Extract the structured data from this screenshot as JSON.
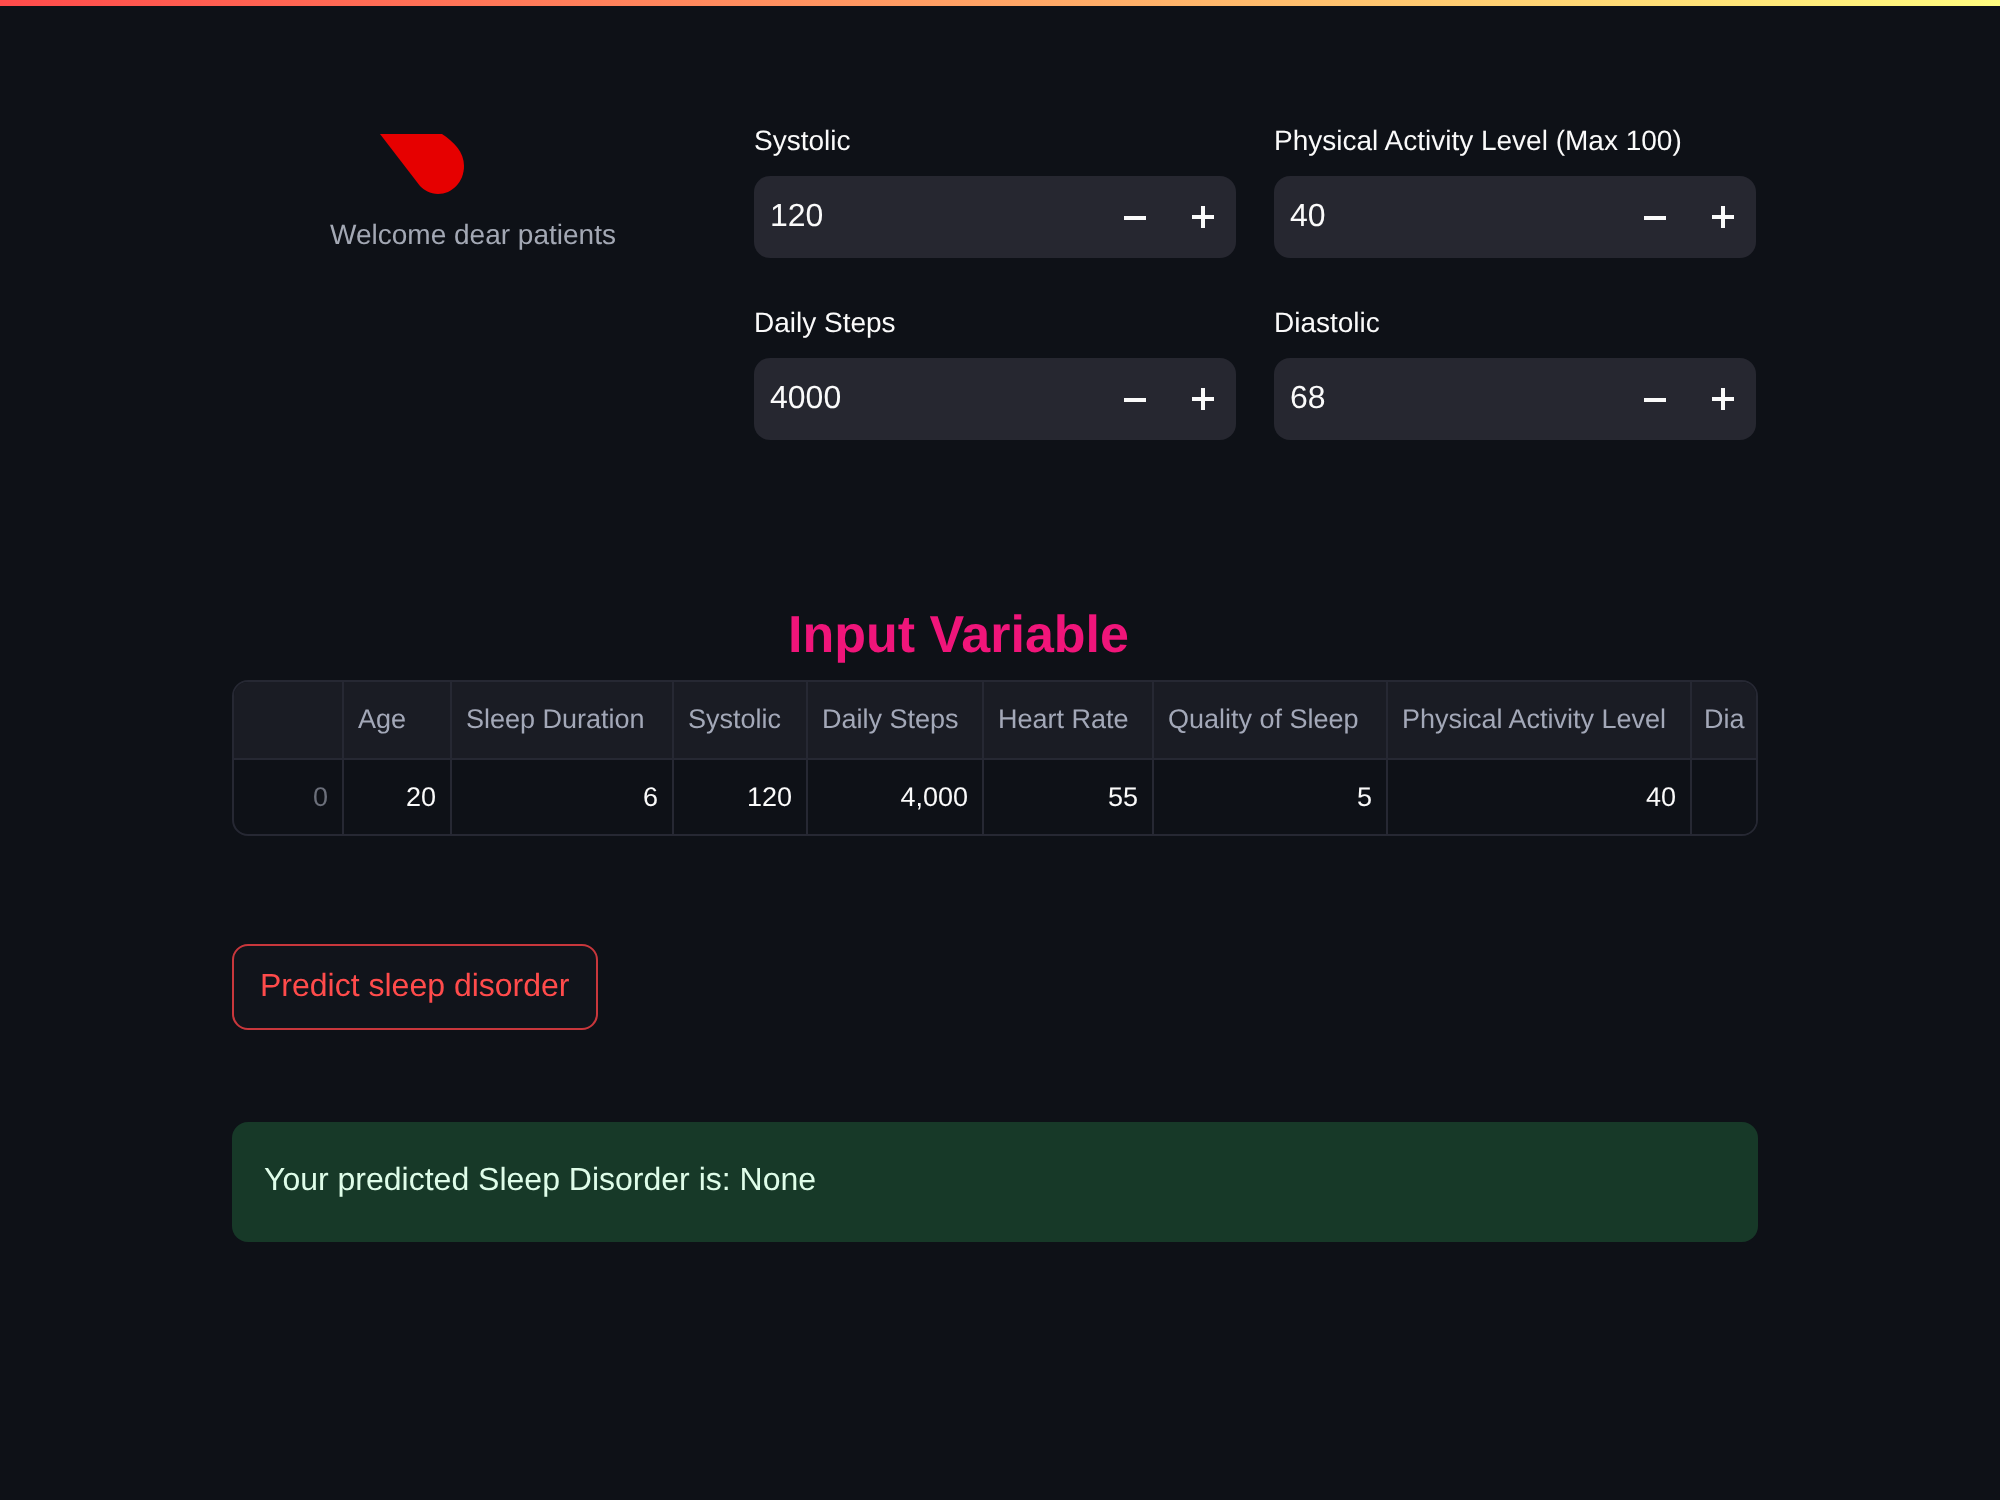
{
  "intro": {
    "welcome_text": "Welcome dear patients"
  },
  "number_inputs": [
    {
      "label": "Systolic",
      "value": "120"
    },
    {
      "label": "Physical Activity Level (Max 100)",
      "value": "40"
    },
    {
      "label": "Daily Steps",
      "value": "4000"
    },
    {
      "label": "Diastolic",
      "value": "68"
    }
  ],
  "section_title": "Input Variable",
  "table": {
    "columns": [
      "Age",
      "Sleep Duration",
      "Systolic",
      "Daily Steps",
      "Heart Rate",
      "Quality of Sleep",
      "Physical Activity Level",
      "Dia"
    ],
    "rows": [
      {
        "index": "0",
        "cells": [
          "20",
          "6",
          "120",
          "4,000",
          "55",
          "5",
          "40"
        ]
      }
    ]
  },
  "predict_button": {
    "label": "Predict sleep disorder"
  },
  "result": {
    "kind": "success",
    "text": "Your predicted Sleep Disorder is: None"
  }
}
